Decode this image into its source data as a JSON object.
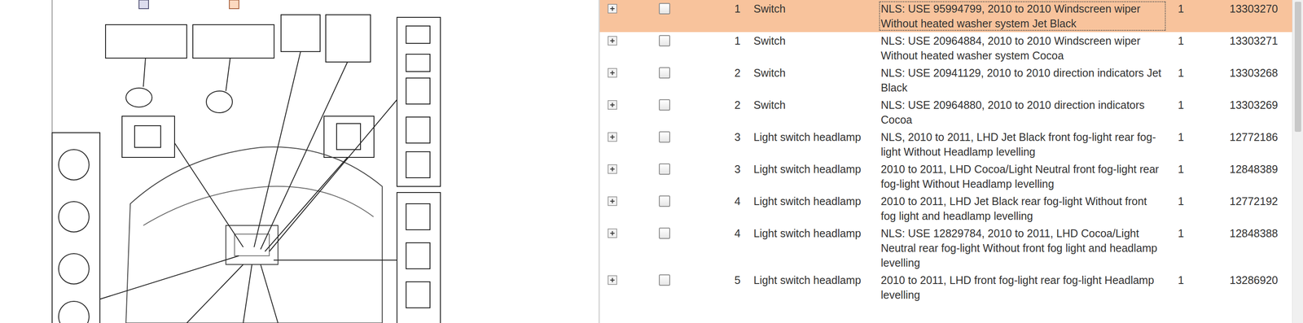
{
  "table": {
    "rows": [
      {
        "ref": "1",
        "name": "Switch",
        "description": "NLS: USE 95994799, 2010 to 2010 Windscreen wiper Without heated washer system Jet Black",
        "qty": "1",
        "part": "13303270",
        "selected": true,
        "checked": false
      },
      {
        "ref": "1",
        "name": "Switch",
        "description": "NLS: USE 20964884, 2010 to 2010 Windscreen wiper Without heated washer system Cocoa",
        "qty": "1",
        "part": "13303271",
        "selected": false,
        "checked": false
      },
      {
        "ref": "2",
        "name": "Switch",
        "description": "NLS: USE 20941129, 2010 to 2010 direction indicators Jet Black",
        "qty": "1",
        "part": "13303268",
        "selected": false,
        "checked": false
      },
      {
        "ref": "2",
        "name": "Switch",
        "description": "NLS: USE 20964880, 2010 to 2010 direction indicators Cocoa",
        "qty": "1",
        "part": "13303269",
        "selected": false,
        "checked": false
      },
      {
        "ref": "3",
        "name": "Light switch headlamp",
        "description": "NLS, 2010 to 2011, LHD Jet Black front fog-light rear fog-light Without Headlamp levelling",
        "qty": "1",
        "part": "12772186",
        "selected": false,
        "checked": false
      },
      {
        "ref": "3",
        "name": "Light switch headlamp",
        "description": "2010 to 2011, LHD Cocoa/Light Neutral front fog-light rear fog-light Without Headlamp levelling",
        "qty": "1",
        "part": "12848389",
        "selected": false,
        "checked": false
      },
      {
        "ref": "4",
        "name": "Light switch headlamp",
        "description": "2010 to 2011, LHD Jet Black rear fog-light Without front fog light and headlamp levelling",
        "qty": "1",
        "part": "12772192",
        "selected": false,
        "checked": false
      },
      {
        "ref": "4",
        "name": "Light switch headlamp",
        "description": "NLS: USE 12829784, 2010 to 2011, LHD Cocoa/Light Neutral rear fog-light Without front fog light and headlamp levelling",
        "qty": "1",
        "part": "12848388",
        "selected": false,
        "checked": false
      },
      {
        "ref": "5",
        "name": "Light switch headlamp",
        "description": "2010 to 2011, LHD front fog-light rear fog-light Headlamp levelling",
        "qty": "1",
        "part": "13286920",
        "selected": false,
        "checked": false
      }
    ]
  }
}
